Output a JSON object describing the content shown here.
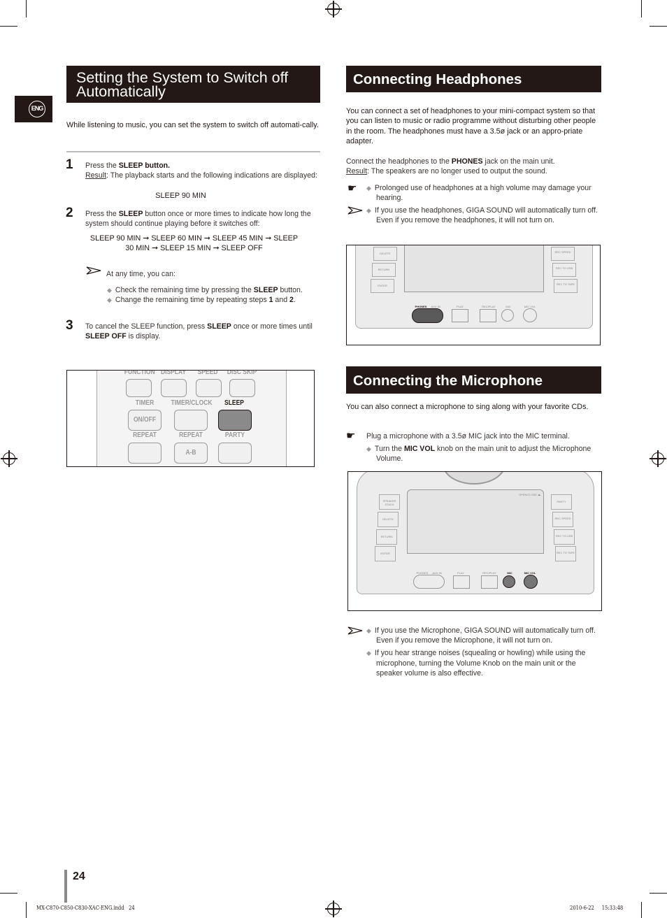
{
  "lang_tab": "ENG",
  "left": {
    "title_line1": "Setting the System to Switch off",
    "title_line2": "Automatically",
    "intro": "While listening to music, you can set the system to switch off automati-cally.",
    "steps": [
      {
        "num": "1",
        "a": "Press the ",
        "b": "SLEEP",
        "c": " button.",
        "result_label": "Result",
        "result_text": ": The playback starts and the following indications are displayed:",
        "display": "SLEEP 90 MIN"
      },
      {
        "num": "2",
        "a": "Press the ",
        "b": "SLEEP",
        "c": " button once or more times to indicate how long the system should continue playing before it switches off:",
        "seq_line1": "SLEEP 90 MIN ➞ SLEEP 60 MIN ➞ SLEEP 45 MIN ➞ SLEEP",
        "seq_line2": "30 MIN ➞ SLEEP 15 MIN ➞ SLEEP OFF"
      },
      {
        "num": "3",
        "a": "To cancel the SLEEP function, press ",
        "b": "SLEEP",
        "c": " once or more times until ",
        "d": "SLEEP OFF",
        "e": " is display."
      }
    ],
    "note_intro": "At any time, you can:",
    "note_items": [
      {
        "a": "Check the remaining time by pressing the ",
        "b": "SLEEP",
        "c": " button."
      },
      {
        "a": "Change the remaining time by repeating steps ",
        "b": "1",
        "c": " and ",
        "d": "2",
        "e": "."
      }
    ],
    "remote": {
      "row1": [
        "FUNCTION",
        "DISPLAY",
        "SPEED",
        "DISC SKIP"
      ],
      "row2": [
        "TIMER",
        "TIMER/CLOCK",
        "SLEEP"
      ],
      "row2_btn": "ON/OFF",
      "row3": [
        "REPEAT",
        "REPEAT",
        "PARTY"
      ],
      "row3_btn": "A-B",
      "highlight_color": "#8a8a8a"
    }
  },
  "headphones": {
    "title": "Connecting Headphones",
    "intro": "You can connect a set of headphones to your mini-compact system so that you can listen to music or radio programme without disturbing other people in the room. The headphones must have a 3.5ø jack or an appro-priate adapter.",
    "connect_a": "Connect the headphones to the ",
    "connect_b": "PHONES",
    "connect_c": " jack on the main unit.",
    "result_label": "Result",
    "result_text": ": The speakers are no longer used to output the sound.",
    "caution": "Prolonged use of headphones at a high volume may damage your hearing.",
    "note": "If you use the headphones, GIGA SOUND will automatically turn off. Even if you remove the headphones, it will not turn on.",
    "panel": {
      "left_buttons": [
        "DELETE",
        "RETURN",
        "ENTER"
      ],
      "right_buttons": [
        "REC SPEED",
        "REC TO USB",
        "REC TO TAPE"
      ],
      "jacks": [
        "PHONES",
        "AUX IN",
        "PLAY",
        "REC/PLAY",
        "MIC",
        "MIC VOL"
      ]
    }
  },
  "microphone": {
    "title": "Connecting the Microphone",
    "intro": "You can also connect a microphone to sing along with your favorite CDs.",
    "caution": "Plug a microphone with a 3.5ø MIC jack into the MIC terminal.",
    "bullet_a": "Turn the ",
    "bullet_b": "MIC VOL",
    "bullet_c": " knob on the main unit to adjust the Microphone Volume.",
    "notes": [
      "If you use the Microphone, GIGA SOUND will automatically turn off. Even if you remove the Microphone, it will not turn on.",
      "If you hear strange noises (squealing or howling) while using the microphone, turning  the Volume Knob on the main unit or the speaker volume is also effective."
    ],
    "panel": {
      "open_close": "OPEN/CLOSE ⏏",
      "left_buttons": [
        "SPEAKER STACK",
        "DELETE",
        "RETURN",
        "ENTER"
      ],
      "right_buttons": [
        "PARTY",
        "REC SPEED",
        "REC TO USB",
        "REC TO TAPE"
      ],
      "jacks": [
        "PHONES",
        "AUX IN",
        "PLAY",
        "REC/PLAY",
        "MIC",
        "MIC VOL"
      ]
    }
  },
  "footer": {
    "page_number": "24",
    "file": "MX-C870-C850-C830-XAC-ENG.indd   24",
    "date": "2010-6-22",
    "time": "15:33:48"
  }
}
